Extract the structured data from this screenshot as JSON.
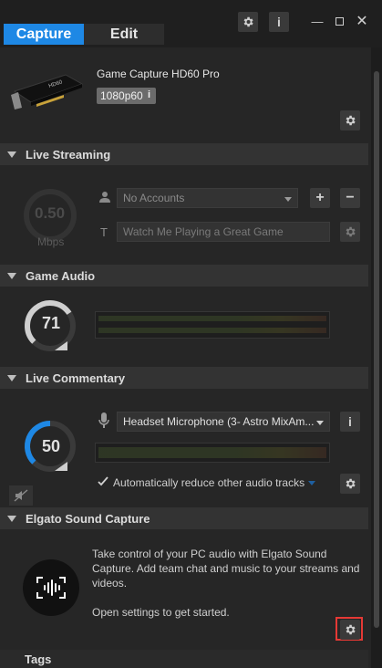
{
  "tabs": {
    "capture": "Capture",
    "edit": "Edit"
  },
  "device": {
    "name": "Game Capture HD60 Pro",
    "resolution": "1080p60",
    "info_glyph": "i"
  },
  "live_streaming": {
    "title": "Live Streaming",
    "bitrate_value": "0.50",
    "bitrate_unit": "Mbps",
    "accounts_placeholder": "No Accounts",
    "title_placeholder": "Watch Me Playing a Great Game",
    "add": "+",
    "remove": "−"
  },
  "game_audio": {
    "title": "Game Audio",
    "level": "71",
    "level_fraction": 0.71
  },
  "live_commentary": {
    "title": "Live Commentary",
    "level": "50",
    "level_fraction": 0.5,
    "microphone": "Headset Microphone (3- Astro MixAm...",
    "auto_reduce": "Automatically reduce other audio tracks",
    "info_glyph": "i"
  },
  "sound_capture": {
    "title": "Elgato Sound Capture",
    "line1": "Take control of your PC audio with Elgato Sound",
    "line2": "Capture. Add team chat and music to your streams and",
    "line3": "videos.",
    "cta": "Open settings to get started."
  },
  "tags": {
    "title": "Tags"
  },
  "colors": {
    "accent": "#1e88e5",
    "highlight": "#e53935"
  }
}
